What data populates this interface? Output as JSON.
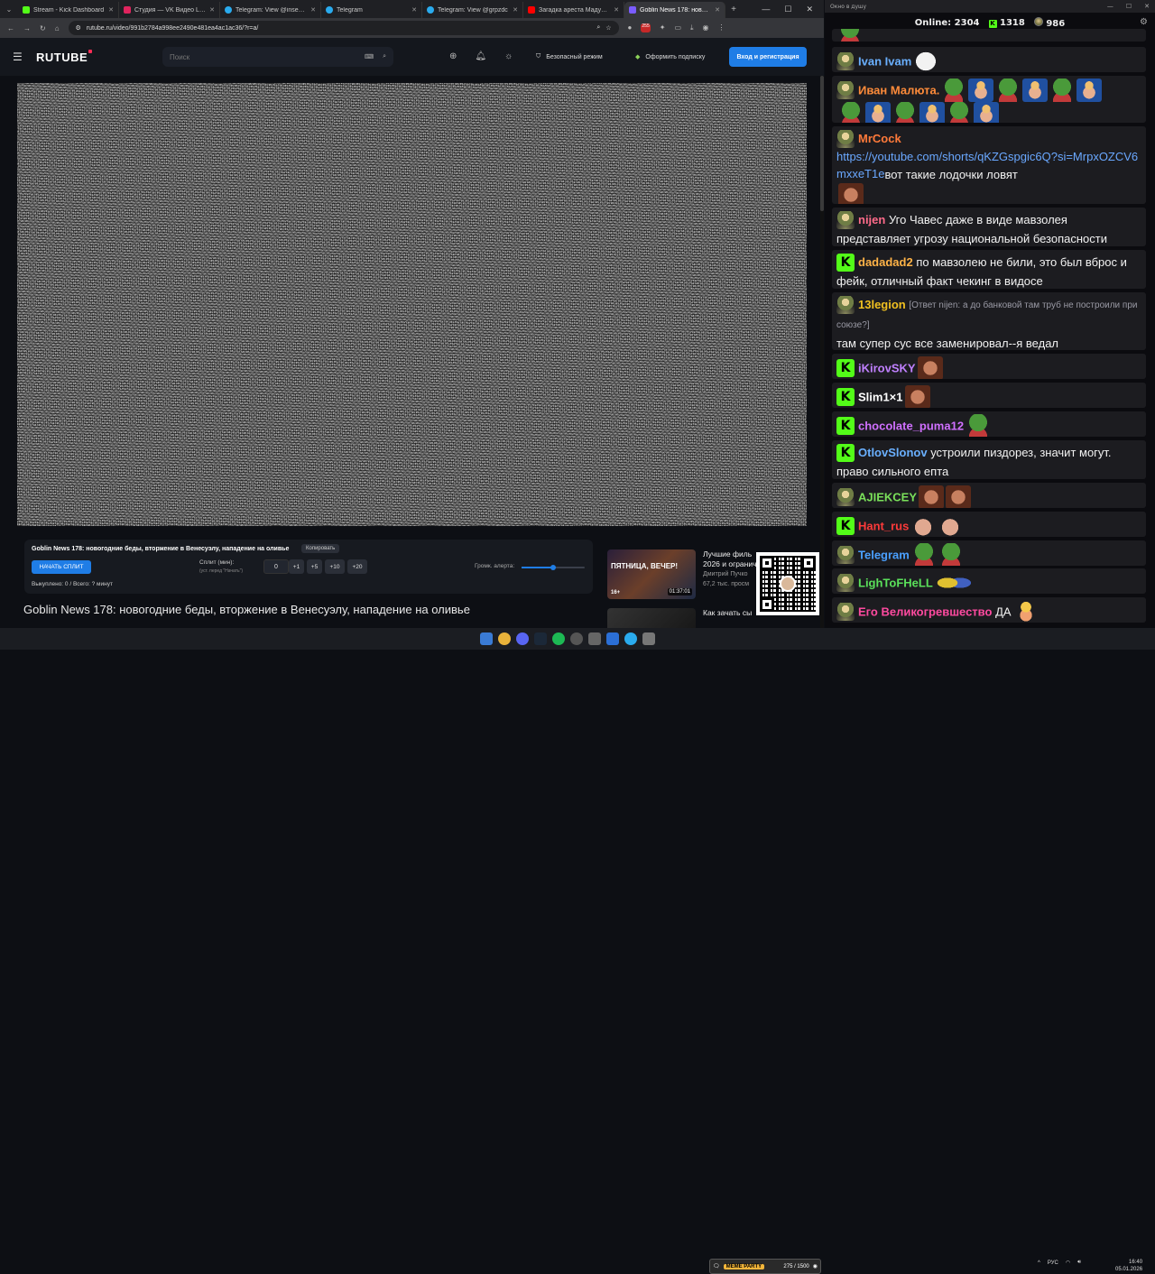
{
  "browser": {
    "tabs": [
      {
        "title": "Stream - Kick Dashboard",
        "color": "#53fc18"
      },
      {
        "title": "Студия — VK Видео Live",
        "color": "#e0245e"
      },
      {
        "title": "Telegram: View @insect_life",
        "color": "#2aabee"
      },
      {
        "title": "Telegram",
        "color": "#2aabee"
      },
      {
        "title": "Telegram: View @grpzdc",
        "color": "#2aabee"
      },
      {
        "title": "Загадка ареста Мадуро: в...",
        "color": "#ff0000"
      },
      {
        "title": "Goblin News 178: новог...",
        "color": "#7a5cff",
        "active": true
      }
    ],
    "url": "rutube.ru/video/991b2784a998ee2490e481ea4ac1ac36/?r=a/",
    "ext_badge": "255"
  },
  "rutube": {
    "logo": "RUTUBE",
    "search_placeholder": "Поиск",
    "safe_mode": "Безопасный режим",
    "subscribe": "Оформить подписку",
    "login": "Вход и регистрация"
  },
  "panel": {
    "title": "Goblin News 178: новогодние беды, вторжение в Венесуэлу, нападение на оливье",
    "copy": "Копировать",
    "start": "НАЧАТЬ СПЛИТ",
    "split_label": "Сплит (мин):",
    "split_hint": "(уст. перед \"Начать\")",
    "split_value": "0",
    "increments": [
      "+1",
      "+5",
      "+10",
      "+20"
    ],
    "volume_label": "Громк. алерта:",
    "volume_level": 0.5,
    "stats": "Выкуплено: 0 / Всего: ? минут"
  },
  "video_title": "Goblin News 178: новогодние беды, вторжение в Венесуэлу, нападение на оливье",
  "recommendations": [
    {
      "title": "Лучшие филь",
      "title2": "2026 и огранич",
      "channel": "Дмитрий Пучко",
      "views": "67,2 тыс. просм",
      "duration": "01:37:01",
      "overlay": "ПЯТНИЦА, ВЕЧЕР!",
      "age": "16+"
    },
    {
      "title": "Как зачать сы",
      "title2": "",
      "channel": "",
      "views": "",
      "duration": "",
      "overlay": "",
      "age": ""
    }
  ],
  "chat": {
    "window_title": "Окно в душу",
    "online_label": "Online:",
    "online": "2304",
    "kick_count": "1318",
    "goblin_count": "986",
    "messages": [
      {
        "nick": "Ivan Ivam",
        "color": "#6ab0ff",
        "text": "",
        "src": "gob"
      },
      {
        "nick": "Иван Малюта.",
        "color": "#ff8c3a",
        "text": "",
        "src": "gob"
      },
      {
        "nick": "MrCock",
        "color": "#ff7a3a",
        "link": "https://youtube.com/shorts/qKZGspgic6Q?si=MrpxOZCV6mxxeT1e",
        "text": "вот такие лодочки ловят",
        "src": "gob"
      },
      {
        "nick": "nijen",
        "color": "#ff6b8a",
        "text": "Уго Чавес даже в виде мавзолея представляет угрозу национальной безопасности",
        "src": "gob"
      },
      {
        "nick": "dadadad2",
        "color": "#ffb347",
        "text": "по мавзолею не били, это был вброс и фейк, отличный факт чекинг в видосе",
        "src": "kick"
      },
      {
        "nick": "13legion",
        "color": "#f0c020",
        "reply": "[Ответ nijen: а до банковой там труб не построили при союзе?]",
        "text": "там супер сус все заменировал--я ведал",
        "src": "gob"
      },
      {
        "nick": "iKirovSKY",
        "color": "#c080ff",
        "text": "",
        "src": "kick"
      },
      {
        "nick": "Slim1×1",
        "color": "#ffffff",
        "text": "",
        "src": "kick"
      },
      {
        "nick": "chocolate_puma12",
        "color": "#d070ff",
        "text": "",
        "src": "kick"
      },
      {
        "nick": "OtlovSlonov",
        "color": "#6ab0ff",
        "text": "устроили пиздорез, значит могут. право сильного епта",
        "src": "kick"
      },
      {
        "nick": "AJIEKCEY",
        "color": "#7ae05a",
        "text": "",
        "src": "gob"
      },
      {
        "nick": "Hant_rus",
        "color": "#ff3a3a",
        "text": "",
        "src": "kick"
      },
      {
        "nick": "Telegram",
        "color": "#4aa0ff",
        "text": "",
        "src": "gob"
      },
      {
        "nick": "LighToFHeLL",
        "color": "#5ae05a",
        "text": "",
        "src": "gob"
      },
      {
        "nick": "Его Великогревшество",
        "color": "#ff4aa0",
        "text": "ДА",
        "src": "gob"
      }
    ]
  },
  "taskbar": {
    "meme_party": "MEME PARTY",
    "meme_count": "275 / 1500",
    "lang": "РУС",
    "time": "16:40",
    "date": "05.01.2026"
  }
}
